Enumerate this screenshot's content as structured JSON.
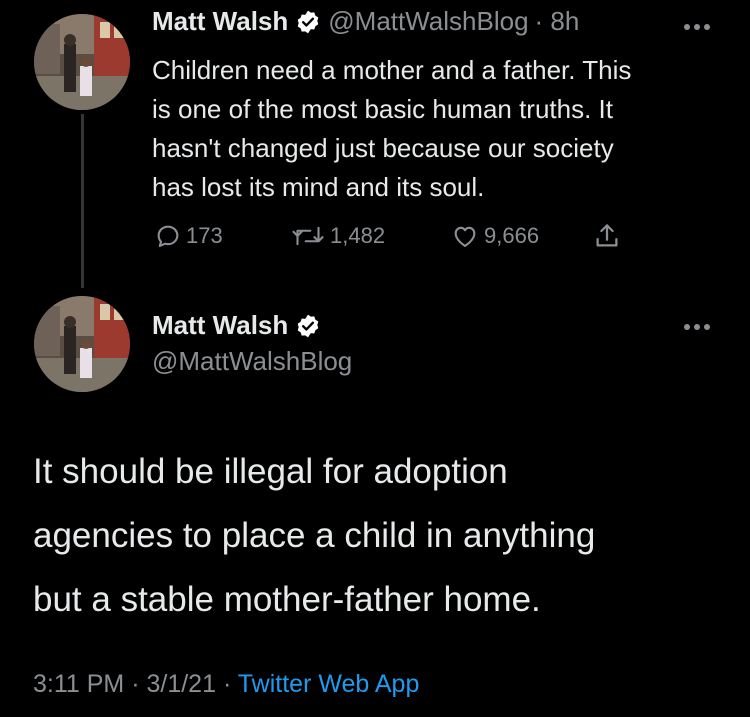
{
  "colors": {
    "background": "#000000",
    "text": "#e7e9ea",
    "secondary": "#8b8f94",
    "link": "#1d9bf0",
    "verified_badge": "#ffffff"
  },
  "tweet1": {
    "name": "Matt Walsh",
    "handle": "@MattWalshBlog",
    "time": "· 8h",
    "text_lines": [
      "Children need a mother and a father. This",
      "is one of the most basic human truths. It",
      "hasn't changed just because our society",
      "has lost its mind and its soul."
    ],
    "actions": {
      "reply_count": "173",
      "retweet_count": "1,482",
      "like_count": "9,666"
    },
    "icons": [
      "reply-icon",
      "retweet-icon",
      "like-icon",
      "share-icon",
      "more-icon"
    ]
  },
  "tweet2": {
    "name": "Matt Walsh",
    "handle": "@MattWalshBlog",
    "text_lines": [
      "It should be illegal for adoption",
      "agencies to place a child in anything",
      "but a stable mother-father home."
    ],
    "meta": {
      "time": "3:11 PM",
      "separator": "·",
      "date": "3/1/21",
      "app": "Twitter Web App"
    }
  }
}
